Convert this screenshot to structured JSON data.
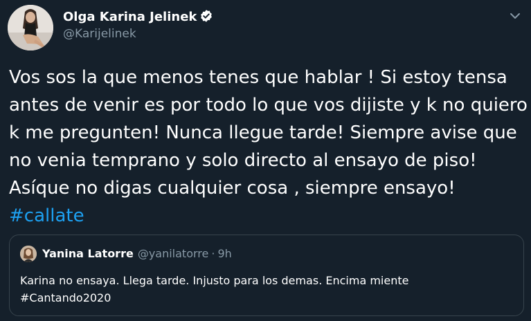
{
  "author": {
    "name": "Olga Karina Jelinek",
    "handle": "@Karijelinek",
    "verified": true
  },
  "tweet": {
    "lines": [
      "Vos sos la que menos tenes que hablar ! Si estoy tensa",
      "antes de venir es por todo lo que vos dijiste y k no quiero",
      "k me pregunten! Nunca llegue tarde! Siempre avise que",
      "no venia temprano y solo directo al ensayo de piso!",
      "Asíque no digas cualquier cosa , siempre ensayo!"
    ],
    "hashtag": "#callate"
  },
  "quoted_tweet": {
    "name": "Yanina Latorre",
    "handle": "@yanilatorre",
    "separator": "·",
    "time": "9h",
    "lines": [
      "Karina no ensaya. Llega tarde. Injusto para los demas. Encima miente",
      "#Cantando2020"
    ]
  },
  "icons": {
    "verified": "verified-badge-icon",
    "menu": "chevron-down-icon"
  },
  "colors": {
    "background": "#15202b",
    "link": "#1da1f2",
    "secondary_text": "#8899a6",
    "border": "#38444d"
  }
}
